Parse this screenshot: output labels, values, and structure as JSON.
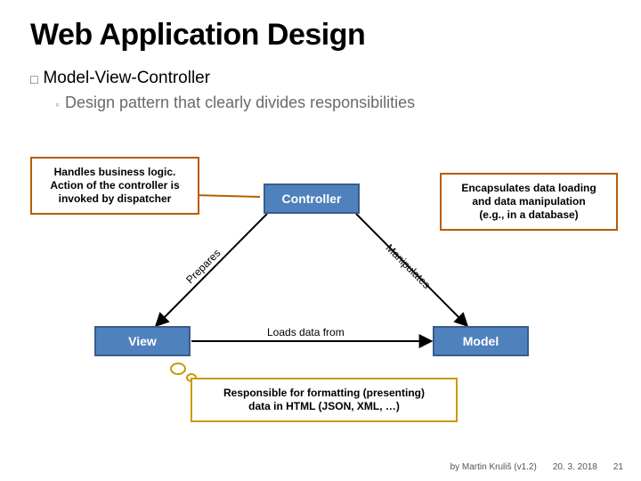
{
  "title": "Web Application Design",
  "bullet1": "Model-View-Controller",
  "bullet2": "Design pattern that clearly divides responsibilities",
  "callouts": {
    "controller": "Handles business logic.\nAction of the controller is\ninvoked by dispatcher",
    "model": "Encapsulates data loading\nand data manipulation\n(e.g., in a database)",
    "view": "Responsible for formatting (presenting)\ndata in HTML (JSON, XML, …)"
  },
  "nodes": {
    "controller": "Controller",
    "view": "View",
    "model": "Model"
  },
  "edges": {
    "prepares": "Prepares",
    "manipulates": "Manipulates",
    "loads": "Loads data from"
  },
  "footer": {
    "author": "by Martin Kruliš (v1.2)",
    "date": "20. 3. 2018",
    "page": "21"
  }
}
